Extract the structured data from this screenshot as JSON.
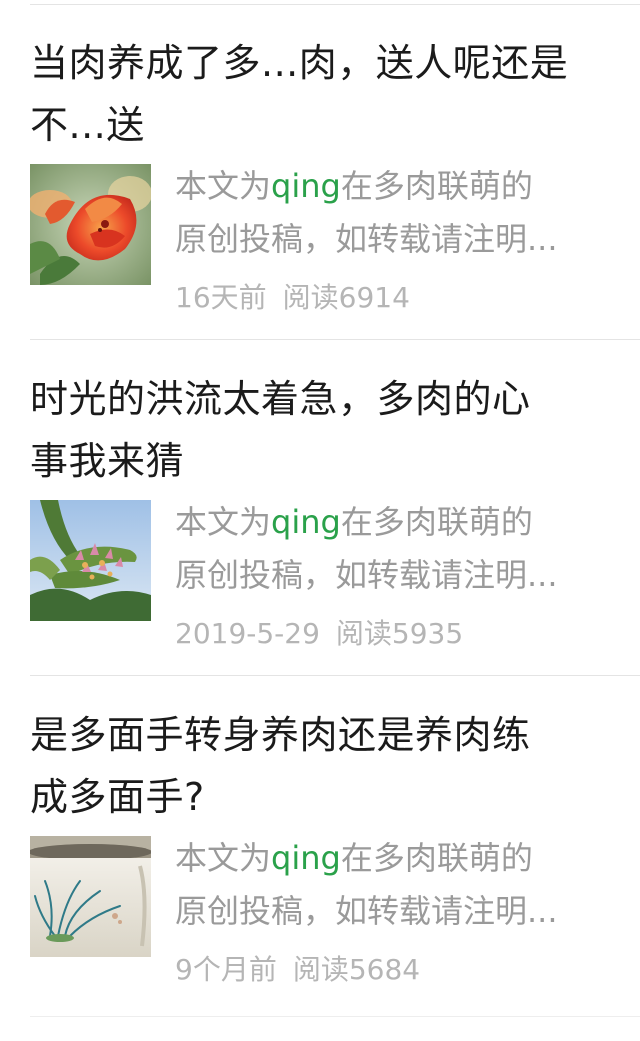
{
  "articles": [
    {
      "title_line1": "当肉养成了多...肉，送人呢还是",
      "title_line2": "不...送",
      "summary_prefix": "本文为",
      "summary_author": "qing",
      "summary_suffix": "在多肉联萌的",
      "summary_line2": "原创投稿，如转载请注明...",
      "time": "16天前",
      "reads": "阅读6914",
      "thumbnail": "red-succulent-flower-photo"
    },
    {
      "title_line1": "时光的洪流太着急，多肉的心",
      "title_line2": "事我来猜",
      "summary_prefix": "本文为",
      "summary_author": "qing",
      "summary_suffix": "在多肉联萌的",
      "summary_line2": "原创投稿，如转载请注明...",
      "time": "2019-5-29",
      "reads": "阅读5935",
      "thumbnail": "kalanchoe-plantlets-photo"
    },
    {
      "title_line1": "是多面手转身养肉还是养肉练",
      "title_line2": "成多面手?",
      "summary_prefix": "本文为",
      "summary_author": "qing",
      "summary_suffix": "在多肉联萌的",
      "summary_line2": "原创投稿，如转载请注明...",
      "time": "9个月前",
      "reads": "阅读5684",
      "thumbnail": "painted-ceramic-pot-photo"
    }
  ],
  "colors": {
    "title": "#1b1b1b",
    "summary": "#9a9a9a",
    "author_highlight": "#2aa14a",
    "meta": "#b5b5b5",
    "divider": "#e4e4e4"
  }
}
